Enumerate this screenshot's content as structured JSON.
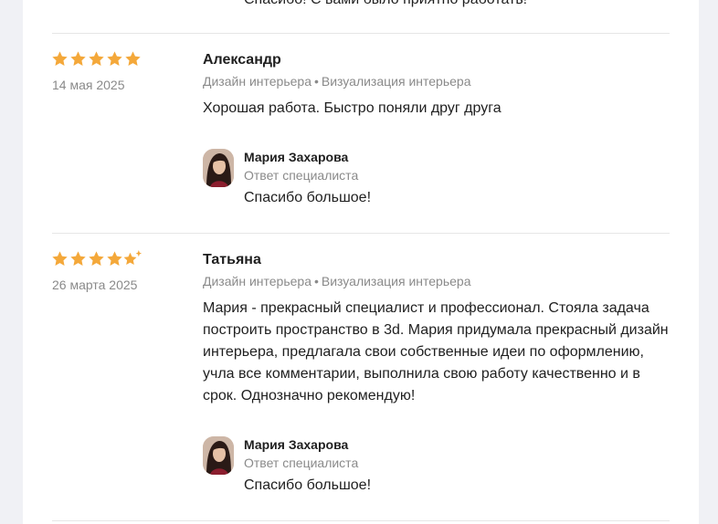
{
  "previous_reply": {
    "text": "Спасибо! С вами было приятно работать!"
  },
  "reviews": [
    {
      "rating": 5,
      "date": "14 мая 2025",
      "author": "Александр",
      "services": [
        "Дизайн интерьера",
        "Визуализация интерьера"
      ],
      "text": "Хорошая работа. Быстро поняли друг друга",
      "reply": {
        "name": "Мария Захарова",
        "role": "Ответ специалиста",
        "text": "Спасибо большое!"
      }
    },
    {
      "rating": 4.5,
      "date": "26 марта 2025",
      "author": "Татьяна",
      "services": [
        "Дизайн интерьера",
        "Визуализация интерьера"
      ],
      "text": "Мария - прекрасный специалист и профессионал. Стояла задача построить пространство в 3d. Мария придумала прекрасный дизайн интерьера, предлагала свои собственные идеи по оформлению, учла все комментарии, выполнила свою работу качественно и в срок. Однозначно рекомендую!",
      "reply": {
        "name": "Мария Захарова",
        "role": "Ответ специалиста",
        "text": "Спасибо большое!"
      }
    }
  ],
  "colors": {
    "star": "#f4a83a",
    "page_bg": "#f0f1f5",
    "card_bg": "#ffffff",
    "muted_text": "#8a8a8a"
  },
  "services_separator": "•"
}
